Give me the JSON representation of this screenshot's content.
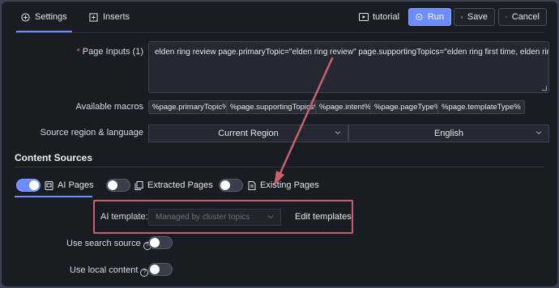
{
  "header": {
    "tabs": [
      {
        "label": "Settings",
        "icon": "plus-circle-icon",
        "active": true
      },
      {
        "label": "Inserts",
        "icon": "insert-square-icon",
        "active": false
      }
    ],
    "tutorial_label": "tutorial",
    "buttons": {
      "run": "Run",
      "save": "Save",
      "cancel": "Cancel"
    }
  },
  "form": {
    "page_inputs": {
      "label": "Page Inputs (1)",
      "value": "elden ring review page.primaryTopic=\"elden ring review\" page.supportingTopics=\"elden ring first time, elden ring intro, e"
    },
    "macros": {
      "label": "Available macros",
      "items": [
        "%page.primaryTopic%",
        "%page.supportingTopics%",
        "%page.intent%",
        "%page.pageType%",
        "%page.templateType%"
      ]
    },
    "region_language": {
      "label": "Source region & language",
      "region": "Current Region",
      "language": "English"
    }
  },
  "content_sources": {
    "title": "Content Sources",
    "sources": [
      {
        "label": "AI Pages",
        "on": true
      },
      {
        "label": "Extracted Pages",
        "on": false
      },
      {
        "label": "Existing Pages",
        "on": false
      }
    ],
    "ai_template": {
      "label": "AI template:",
      "placeholder": "Managed by cluster topics",
      "edit_label": "Edit templates"
    },
    "options": [
      {
        "label": "Use search source",
        "on": false
      },
      {
        "label": "Use local content",
        "on": false
      }
    ]
  },
  "colors": {
    "accent": "#6d8cff",
    "background": "#1a1c24",
    "annotation": "#c9606a",
    "required": "#ff5c5c"
  }
}
